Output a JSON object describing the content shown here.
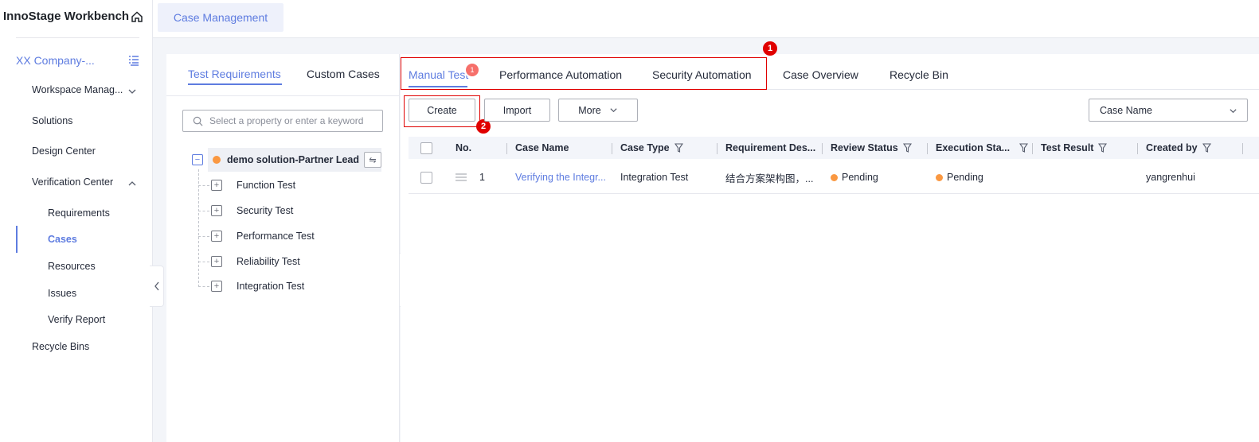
{
  "brand": {
    "title": "InnoStage Workbench",
    "home_icon": "home-icon"
  },
  "leftnav": {
    "project": "XX Company-...",
    "items": [
      {
        "label": "Workspace Manag..."
      },
      {
        "label": "Solutions"
      },
      {
        "label": "Design Center"
      },
      {
        "label": "Verification Center"
      }
    ],
    "sub_items": [
      {
        "label": "Requirements"
      },
      {
        "label": "Cases"
      },
      {
        "label": "Resources"
      },
      {
        "label": "Issues"
      },
      {
        "label": "Verify Report"
      }
    ],
    "recycle": "Recycle Bins"
  },
  "top_tab": {
    "label": "Case Management"
  },
  "tree": {
    "tabs": [
      "Test Requirements",
      "Custom Cases"
    ],
    "search_placeholder": "Select a property or enter a keyword",
    "root": "demo solution-Partner Lead",
    "children": [
      "Function Test",
      "Security Test",
      "Performance Test",
      "Reliability Test",
      "Integration Test"
    ]
  },
  "main": {
    "tabs": [
      "Manual Test",
      "Performance Automation",
      "Security Automation",
      "Case Overview",
      "Recycle Bin"
    ],
    "manual_badge": "1",
    "callout_1": "1",
    "callout_2": "2",
    "buttons": {
      "create": "Create",
      "import": "Import",
      "more": "More"
    },
    "select_value": "Case Name"
  },
  "table": {
    "headers": [
      "No.",
      "Case Name",
      "Case Type",
      "Requirement Des...",
      "Review Status",
      "Execution Sta...",
      "Test Result",
      "Created by"
    ],
    "rows": [
      {
        "no": "1",
        "case_name": "Verifying the Integr...",
        "case_type": "Integration Test",
        "requirement": "结合方案架构图，...",
        "review_status": "Pending",
        "execution_status": "Pending",
        "test_result": "",
        "created_by": "yangrenhui"
      }
    ]
  },
  "colors": {
    "accent": "#5e7ce0",
    "pending": "#fa9841",
    "callout": "#e00000"
  }
}
